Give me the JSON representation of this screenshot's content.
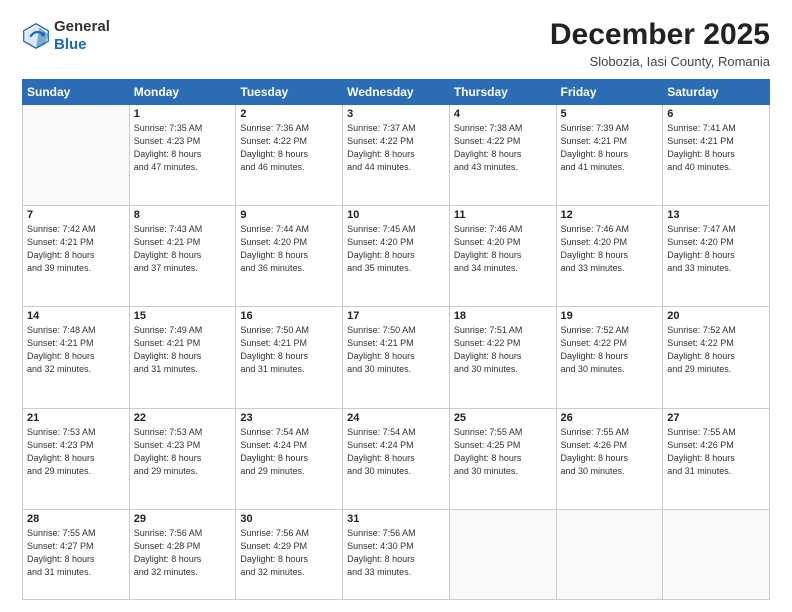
{
  "header": {
    "logo_general": "General",
    "logo_blue": "Blue",
    "month_year": "December 2025",
    "location": "Slobozia, Iasi County, Romania"
  },
  "days_of_week": [
    "Sunday",
    "Monday",
    "Tuesday",
    "Wednesday",
    "Thursday",
    "Friday",
    "Saturday"
  ],
  "weeks": [
    [
      {
        "day": "",
        "info": ""
      },
      {
        "day": "1",
        "info": "Sunrise: 7:35 AM\nSunset: 4:23 PM\nDaylight: 8 hours\nand 47 minutes."
      },
      {
        "day": "2",
        "info": "Sunrise: 7:36 AM\nSunset: 4:22 PM\nDaylight: 8 hours\nand 46 minutes."
      },
      {
        "day": "3",
        "info": "Sunrise: 7:37 AM\nSunset: 4:22 PM\nDaylight: 8 hours\nand 44 minutes."
      },
      {
        "day": "4",
        "info": "Sunrise: 7:38 AM\nSunset: 4:22 PM\nDaylight: 8 hours\nand 43 minutes."
      },
      {
        "day": "5",
        "info": "Sunrise: 7:39 AM\nSunset: 4:21 PM\nDaylight: 8 hours\nand 41 minutes."
      },
      {
        "day": "6",
        "info": "Sunrise: 7:41 AM\nSunset: 4:21 PM\nDaylight: 8 hours\nand 40 minutes."
      }
    ],
    [
      {
        "day": "7",
        "info": "Sunrise: 7:42 AM\nSunset: 4:21 PM\nDaylight: 8 hours\nand 39 minutes."
      },
      {
        "day": "8",
        "info": "Sunrise: 7:43 AM\nSunset: 4:21 PM\nDaylight: 8 hours\nand 37 minutes."
      },
      {
        "day": "9",
        "info": "Sunrise: 7:44 AM\nSunset: 4:20 PM\nDaylight: 8 hours\nand 36 minutes."
      },
      {
        "day": "10",
        "info": "Sunrise: 7:45 AM\nSunset: 4:20 PM\nDaylight: 8 hours\nand 35 minutes."
      },
      {
        "day": "11",
        "info": "Sunrise: 7:46 AM\nSunset: 4:20 PM\nDaylight: 8 hours\nand 34 minutes."
      },
      {
        "day": "12",
        "info": "Sunrise: 7:46 AM\nSunset: 4:20 PM\nDaylight: 8 hours\nand 33 minutes."
      },
      {
        "day": "13",
        "info": "Sunrise: 7:47 AM\nSunset: 4:20 PM\nDaylight: 8 hours\nand 33 minutes."
      }
    ],
    [
      {
        "day": "14",
        "info": "Sunrise: 7:48 AM\nSunset: 4:21 PM\nDaylight: 8 hours\nand 32 minutes."
      },
      {
        "day": "15",
        "info": "Sunrise: 7:49 AM\nSunset: 4:21 PM\nDaylight: 8 hours\nand 31 minutes."
      },
      {
        "day": "16",
        "info": "Sunrise: 7:50 AM\nSunset: 4:21 PM\nDaylight: 8 hours\nand 31 minutes."
      },
      {
        "day": "17",
        "info": "Sunrise: 7:50 AM\nSunset: 4:21 PM\nDaylight: 8 hours\nand 30 minutes."
      },
      {
        "day": "18",
        "info": "Sunrise: 7:51 AM\nSunset: 4:22 PM\nDaylight: 8 hours\nand 30 minutes."
      },
      {
        "day": "19",
        "info": "Sunrise: 7:52 AM\nSunset: 4:22 PM\nDaylight: 8 hours\nand 30 minutes."
      },
      {
        "day": "20",
        "info": "Sunrise: 7:52 AM\nSunset: 4:22 PM\nDaylight: 8 hours\nand 29 minutes."
      }
    ],
    [
      {
        "day": "21",
        "info": "Sunrise: 7:53 AM\nSunset: 4:23 PM\nDaylight: 8 hours\nand 29 minutes."
      },
      {
        "day": "22",
        "info": "Sunrise: 7:53 AM\nSunset: 4:23 PM\nDaylight: 8 hours\nand 29 minutes."
      },
      {
        "day": "23",
        "info": "Sunrise: 7:54 AM\nSunset: 4:24 PM\nDaylight: 8 hours\nand 29 minutes."
      },
      {
        "day": "24",
        "info": "Sunrise: 7:54 AM\nSunset: 4:24 PM\nDaylight: 8 hours\nand 30 minutes."
      },
      {
        "day": "25",
        "info": "Sunrise: 7:55 AM\nSunset: 4:25 PM\nDaylight: 8 hours\nand 30 minutes."
      },
      {
        "day": "26",
        "info": "Sunrise: 7:55 AM\nSunset: 4:26 PM\nDaylight: 8 hours\nand 30 minutes."
      },
      {
        "day": "27",
        "info": "Sunrise: 7:55 AM\nSunset: 4:26 PM\nDaylight: 8 hours\nand 31 minutes."
      }
    ],
    [
      {
        "day": "28",
        "info": "Sunrise: 7:55 AM\nSunset: 4:27 PM\nDaylight: 8 hours\nand 31 minutes."
      },
      {
        "day": "29",
        "info": "Sunrise: 7:56 AM\nSunset: 4:28 PM\nDaylight: 8 hours\nand 32 minutes."
      },
      {
        "day": "30",
        "info": "Sunrise: 7:56 AM\nSunset: 4:29 PM\nDaylight: 8 hours\nand 32 minutes."
      },
      {
        "day": "31",
        "info": "Sunrise: 7:56 AM\nSunset: 4:30 PM\nDaylight: 8 hours\nand 33 minutes."
      },
      {
        "day": "",
        "info": ""
      },
      {
        "day": "",
        "info": ""
      },
      {
        "day": "",
        "info": ""
      }
    ]
  ]
}
